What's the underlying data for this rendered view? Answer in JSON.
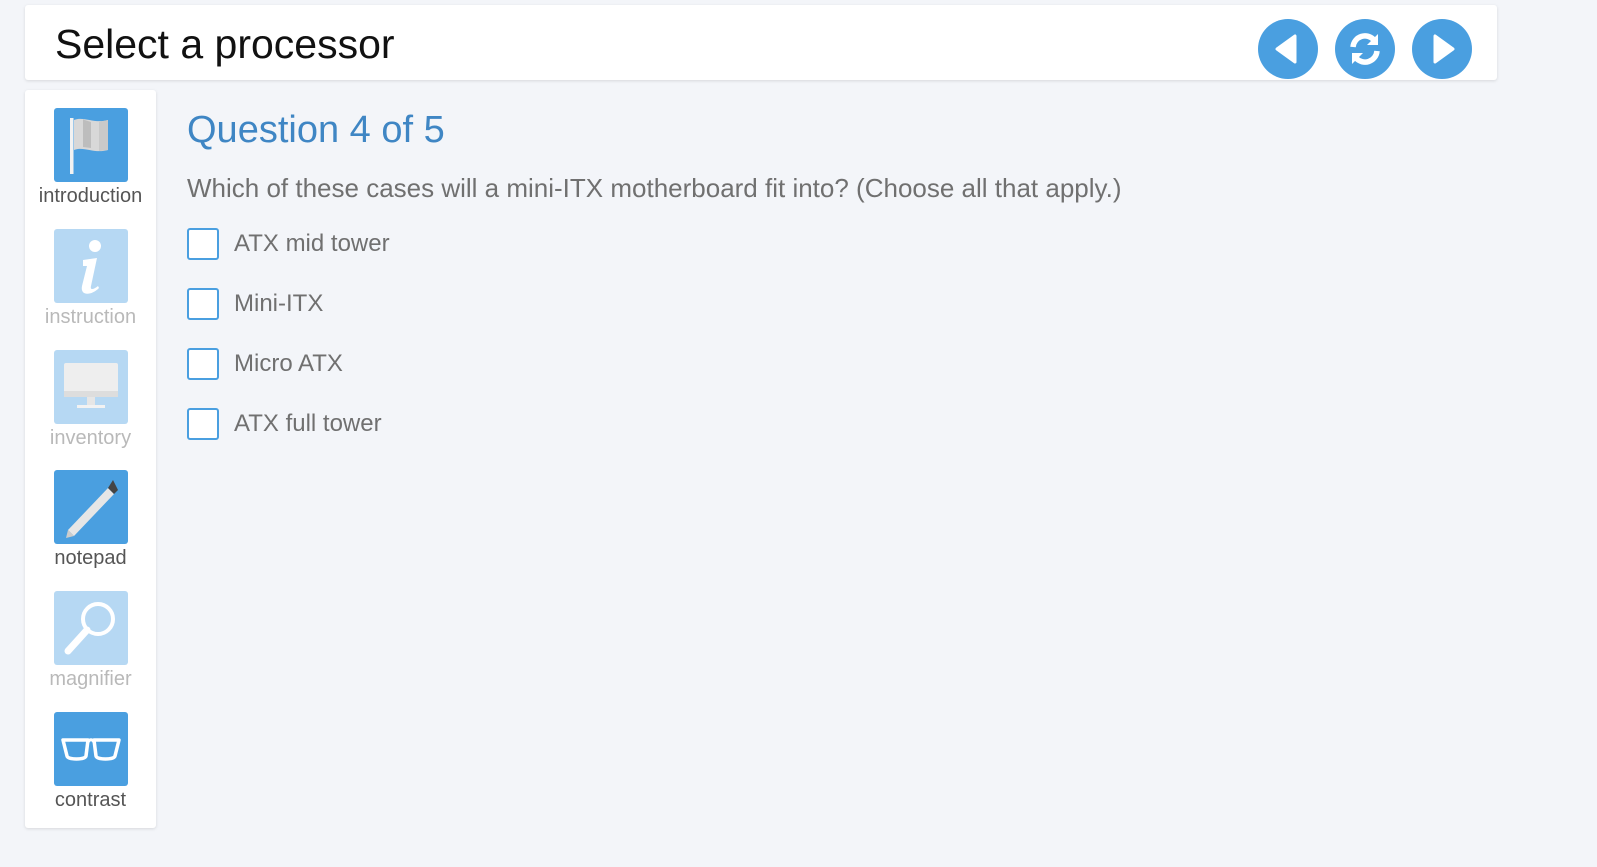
{
  "header": {
    "title": "Select a processor"
  },
  "nav": {
    "buttons": [
      {
        "name": "back",
        "icon": "triangle-left-icon"
      },
      {
        "name": "refresh",
        "icon": "refresh-icon"
      },
      {
        "name": "forward",
        "icon": "triangle-right-icon"
      }
    ]
  },
  "sidebar": {
    "items": [
      {
        "label": "introduction",
        "icon": "flag-icon",
        "state": "active"
      },
      {
        "label": "instruction",
        "icon": "info-icon",
        "state": "disabled"
      },
      {
        "label": "inventory",
        "icon": "monitor-icon",
        "state": "disabled"
      },
      {
        "label": "notepad",
        "icon": "pencil-icon",
        "state": "active"
      },
      {
        "label": "magnifier",
        "icon": "magnifier-icon",
        "state": "disabled"
      },
      {
        "label": "contrast",
        "icon": "glasses-icon",
        "state": "active"
      }
    ]
  },
  "question": {
    "heading": "Question 4 of 5",
    "text": "Which of these cases will a mini-ITX motherboard fit into? (Choose all that apply.)",
    "options": [
      {
        "label": "ATX mid tower",
        "checked": false
      },
      {
        "label": "Mini-ITX",
        "checked": false
      },
      {
        "label": "Micro ATX",
        "checked": false
      },
      {
        "label": "ATX full tower",
        "checked": false
      }
    ]
  },
  "colors": {
    "accent": "#4a9fe0",
    "accent_disabled": "#b6d8f3",
    "heading": "#3f86c4",
    "background": "#f3f5f9"
  }
}
